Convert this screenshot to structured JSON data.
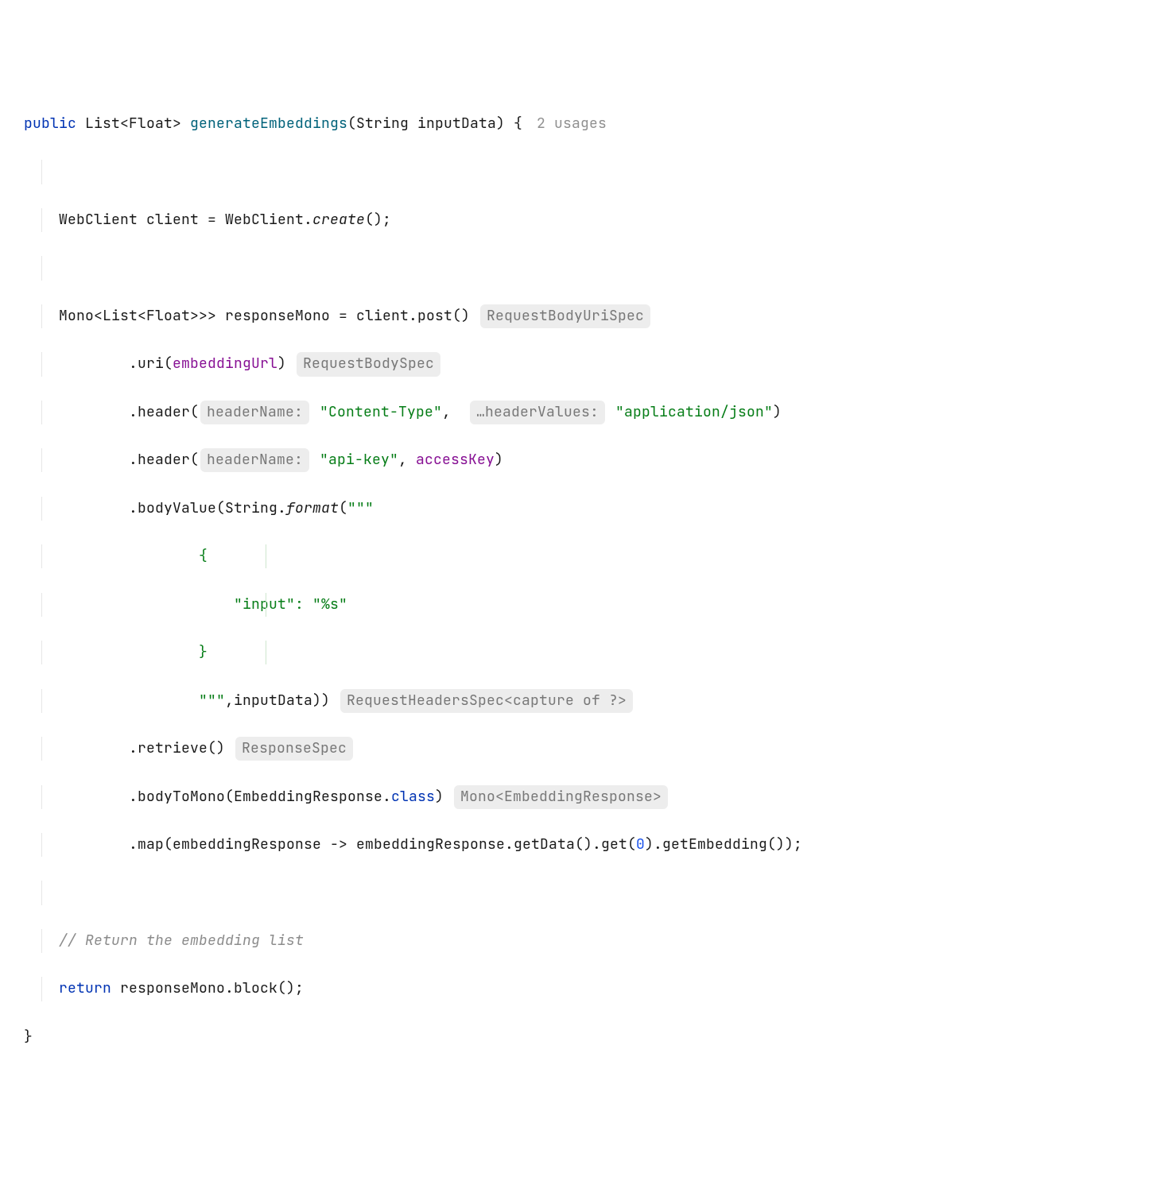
{
  "l1": {
    "public": "public",
    "list": "List",
    "float": "Float",
    "method": "generateEmbeddings",
    "string": "String",
    "param": "inputData",
    "open": ") {",
    "usages": "2 usages"
  },
  "l2": {
    "decl": "WebClient client = WebClient.",
    "create": "create",
    "tail": "();"
  },
  "l3": {
    "a": "Mono<",
    "list": "List",
    "flt": "Float",
    "b": ">> responseMono = client.post()",
    "hint": "RequestBodyUriSpec"
  },
  "l4": {
    "a": ".uri(",
    "field": "embeddingUrl",
    "b": ")",
    "hint": "RequestBodySpec"
  },
  "l5": {
    "a": ".header(",
    "h1": "headerName:",
    "s1": "\"Content-Type\"",
    "c": ",",
    "h2": "…headerValues:",
    "s2": "\"application/json\"",
    "b": ")"
  },
  "l6": {
    "a": ".header(",
    "h1": "headerName:",
    "s1": "\"api-key\"",
    "c": ", ",
    "field": "accessKey",
    "b": ")"
  },
  "l7": {
    "a": ".bodyValue(String.",
    "fmt": "format",
    "b": "(",
    "s": "\"\"\""
  },
  "l8": {
    "s": "{"
  },
  "l9": {
    "s": "    \"input\": \"%s\""
  },
  "l10": {
    "s": "}"
  },
  "l11": {
    "s": "\"\"\"",
    "a": ",inputData))",
    "hint": "RequestHeadersSpec<capture of ?>"
  },
  "l12": {
    "a": ".retrieve()",
    "hint": "ResponseSpec"
  },
  "l13": {
    "a": ".bodyToMono(EmbeddingResponse.",
    "cls": "class",
    "b": ")",
    "hint": "Mono<EmbeddingResponse>"
  },
  "l14": {
    "a": ".map(embeddingResponse -> embeddingResponse.getData().get(",
    "n": "0",
    "b": ").getEmbedding());"
  },
  "l15": {
    "c": "// Return the embedding list"
  },
  "l16": {
    "ret": "return",
    "a": " responseMono.block();"
  },
  "l17": {
    "a": "}"
  }
}
